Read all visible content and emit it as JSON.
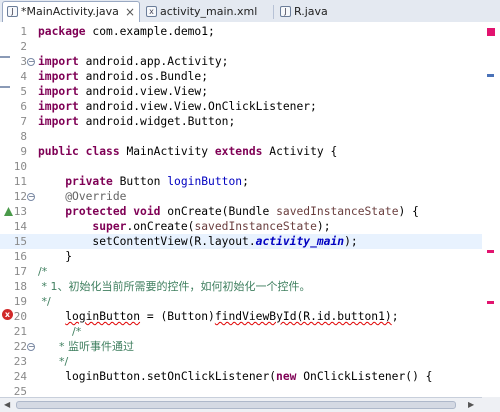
{
  "tabs": [
    {
      "label": "*MainActivity.java",
      "icon": "java-file-icon",
      "close": "×"
    },
    {
      "label": "activity_main.xml",
      "icon": "xml-file-icon"
    },
    {
      "label": "R.java",
      "icon": "java-file-icon"
    }
  ],
  "lines": [
    {
      "n": "1",
      "html": "<span class='kw'>package</span> com.example.demo1;"
    },
    {
      "n": "2",
      "html": ""
    },
    {
      "n": "3",
      "html": "<span class='kw'>import</span> android.app.Activity;"
    },
    {
      "n": "4",
      "html": "<span class='kw'>import</span> android.os.Bundle;"
    },
    {
      "n": "5",
      "html": "<span class='kw'>import</span> android.view.View;"
    },
    {
      "n": "6",
      "html": "<span class='kw'>import</span> android.view.View.OnClickListener;"
    },
    {
      "n": "7",
      "html": "<span class='kw'>import</span> android.widget.Button;"
    },
    {
      "n": "8",
      "html": ""
    },
    {
      "n": "9",
      "html": "<span class='kw'>public</span> <span class='kw'>class</span> MainActivity <span class='kw'>extends</span> Activity {"
    },
    {
      "n": "10",
      "html": ""
    },
    {
      "n": "11",
      "html": "    <span class='kw'>private</span> Button <span class='fld'>loginButton</span>;"
    },
    {
      "n": "12",
      "html": "    <span class='anno'>@Override</span>"
    },
    {
      "n": "13",
      "html": "    <span class='kw'>protected</span> <span class='kw'>void</span> onCreate(Bundle <span class='param'>savedInstanceState</span>) {"
    },
    {
      "n": "14",
      "html": "        <span class='kw'>super</span>.onCreate(<span class='param'>savedInstanceState</span>);"
    },
    {
      "n": "15",
      "html": "        setContentView(R.layout.<span class='st'>activity_main</span>);",
      "hl": true
    },
    {
      "n": "16",
      "html": "    }"
    },
    {
      "n": "17",
      "html": "<span class='cmt'>/*</span>"
    },
    {
      "n": "18",
      "html": "<span class='cmt'> * 1、初始化当前所需要的控件，如何初始化一个控件。</span>"
    },
    {
      "n": "19",
      "html": "<span class='cmt'> */</span>"
    },
    {
      "n": "20",
      "html": "    <span class='err'>loginButton</span> = (Button)<span class='err'>findViewById(R.id.button1)</span>;"
    },
    {
      "n": "21",
      "html": "     <span class='cmt'>/*</span>"
    },
    {
      "n": "22",
      "html": "<span class='cmt'>      * 监听事件通过</span>"
    },
    {
      "n": "23",
      "html": "<span class='cmt'>      */</span>"
    },
    {
      "n": "24",
      "html": "    loginButton.setOnClickListener(<span class='kw'>new</span> OnClickListener() {"
    },
    {
      "n": "25",
      "html": ""
    }
  ],
  "colors": {
    "keyword": "#7f0055",
    "field": "#0000c0",
    "comment": "#3f7f5f",
    "annotation": "#646464",
    "current_line": "#e8f2fe",
    "error": "#d12a2a"
  }
}
